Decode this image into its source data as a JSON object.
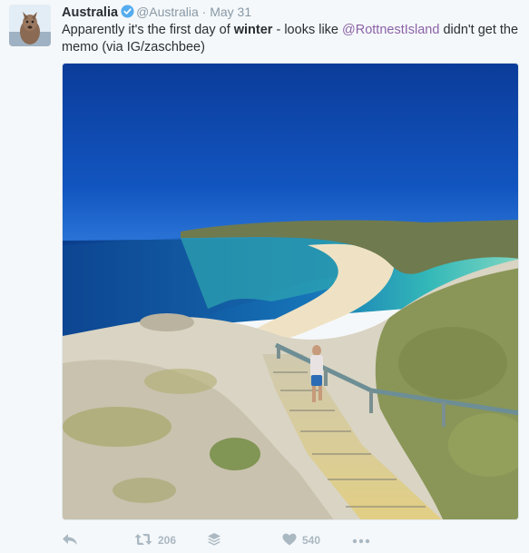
{
  "tweet": {
    "author_name": "Australia",
    "handle": "@Australia",
    "separator": "·",
    "date": "May 31",
    "text_part1": "Apparently it's the first day of ",
    "text_bold": "winter",
    "text_part2": " - looks like ",
    "mention": "@RottnestIsland",
    "text_part3": " didn't get the memo (via IG/zaschbee)"
  },
  "actions": {
    "retweet_count": "206",
    "like_count": "540"
  },
  "colors": {
    "link": "#8b63a8",
    "verified": "#55acee",
    "muted": "#8899a6"
  }
}
